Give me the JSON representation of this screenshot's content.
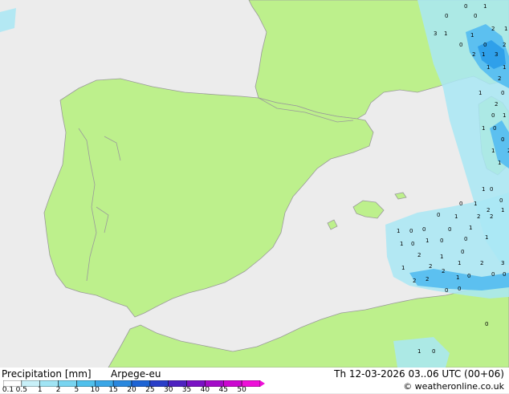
{
  "map": {
    "region": "Iberian Peninsula and Western Mediterranean",
    "colors": {
      "sea": "#ececec",
      "land": "#bdf08c",
      "border": "#9a9a9a",
      "light_rain": "#a9e8f4",
      "moderate_rain": "#5cc0f0",
      "heavy_rain": "#2fa0ea"
    },
    "rain_labels": [
      {
        "v": "0"
      },
      {
        "v": "1"
      },
      {
        "v": "0"
      },
      {
        "v": "0"
      },
      {
        "v": "3"
      },
      {
        "v": "1"
      },
      {
        "v": "1"
      },
      {
        "v": "2"
      },
      {
        "v": "1"
      },
      {
        "v": "0"
      },
      {
        "v": "0"
      },
      {
        "v": "2"
      },
      {
        "v": "1"
      },
      {
        "v": "3"
      },
      {
        "v": "2"
      },
      {
        "v": "1"
      },
      {
        "v": "1"
      },
      {
        "v": "2"
      },
      {
        "v": "1"
      },
      {
        "v": "0"
      },
      {
        "v": "2"
      },
      {
        "v": "0"
      },
      {
        "v": "1"
      },
      {
        "v": "1"
      },
      {
        "v": "0"
      },
      {
        "v": "0"
      },
      {
        "v": "1"
      },
      {
        "v": "2"
      },
      {
        "v": "1"
      },
      {
        "v": "1"
      },
      {
        "v": "0"
      },
      {
        "v": "0"
      },
      {
        "v": "1"
      },
      {
        "v": "0"
      },
      {
        "v": "2"
      },
      {
        "v": "1"
      },
      {
        "v": "0"
      },
      {
        "v": "1"
      },
      {
        "v": "2"
      },
      {
        "v": "2"
      },
      {
        "v": "1"
      },
      {
        "v": "0"
      },
      {
        "v": "0"
      },
      {
        "v": "0"
      },
      {
        "v": "1"
      },
      {
        "v": "1"
      },
      {
        "v": "0"
      },
      {
        "v": "1"
      },
      {
        "v": "0"
      },
      {
        "v": "0"
      },
      {
        "v": "1"
      },
      {
        "v": "0"
      },
      {
        "v": "2"
      },
      {
        "v": "1"
      },
      {
        "v": "1"
      },
      {
        "v": "2"
      },
      {
        "v": "2"
      },
      {
        "v": "1"
      },
      {
        "v": "2"
      },
      {
        "v": "3"
      },
      {
        "v": "2"
      },
      {
        "v": "2"
      },
      {
        "v": "1"
      },
      {
        "v": "0"
      },
      {
        "v": "0"
      },
      {
        "v": "0"
      },
      {
        "v": "0"
      },
      {
        "v": "0"
      },
      {
        "v": "0"
      },
      {
        "v": "1"
      },
      {
        "v": "0"
      }
    ]
  },
  "footer": {
    "title": "Precipitation [mm]",
    "model": "Arpege-eu",
    "datetime": "Th 12-03-2026 03..06 UTC (00+06)",
    "credit": "© weatheronline.co.uk",
    "scale_labels": [
      "0.1",
      "0.5",
      "1",
      "2",
      "5",
      "10",
      "15",
      "20",
      "25",
      "30",
      "35",
      "40",
      "45",
      "50"
    ],
    "scale_colors": [
      "#ffffff",
      "#c8f0f8",
      "#a0e4f4",
      "#78d4f0",
      "#50c0ec",
      "#3aa6e6",
      "#2a88de",
      "#1e64d4",
      "#2a3ec8",
      "#4e22c0",
      "#7a12c4",
      "#a40cc8",
      "#cc08d0",
      "#ee10d8"
    ]
  }
}
